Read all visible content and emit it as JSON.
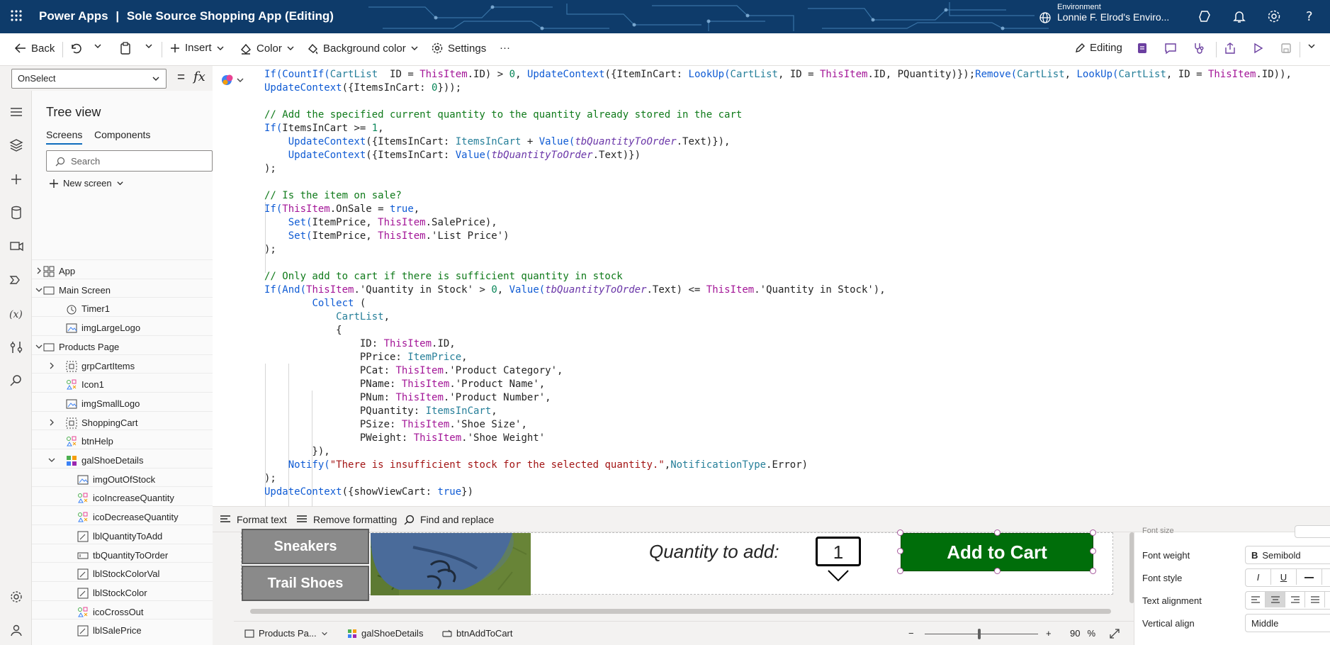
{
  "titlebar": {
    "app_name": "Power Apps",
    "separator": "|",
    "document_title": "Sole Source Shopping App (Editing)",
    "environment_label": "Environment",
    "environment_name": "Lonnie F. Elrod's Enviro..."
  },
  "commandbar": {
    "back": "Back",
    "insert": "Insert",
    "color": "Color",
    "background_color": "Background color",
    "settings": "Settings",
    "more": "···",
    "editing": "Editing"
  },
  "formulabar": {
    "property": "OnSelect",
    "equals": "=",
    "fx": "fx"
  },
  "treeview": {
    "title": "Tree view",
    "tabs": [
      "Screens",
      "Components"
    ],
    "search_placeholder": "Search",
    "new_screen": "New screen",
    "items": [
      {
        "label": "App"
      },
      {
        "label": "Main Screen"
      },
      {
        "label": "Timer1"
      },
      {
        "label": "imgLargeLogo"
      },
      {
        "label": "Products Page"
      },
      {
        "label": "grpCartItems"
      },
      {
        "label": "Icon1"
      },
      {
        "label": "imgSmallLogo"
      },
      {
        "label": "ShoppingCart"
      },
      {
        "label": "btnHelp"
      },
      {
        "label": "galShoeDetails"
      },
      {
        "label": "imgOutOfStock"
      },
      {
        "label": "icoIncreaseQuantity"
      },
      {
        "label": "icoDecreaseQuantity"
      },
      {
        "label": "lblQuantityToAdd"
      },
      {
        "label": "tbQuantityToOrder"
      },
      {
        "label": "lblStockColorVal"
      },
      {
        "label": "lblStockColor"
      },
      {
        "label": "icoCrossOut"
      },
      {
        "label": "lblSalePrice"
      }
    ]
  },
  "editor_footer": {
    "format_text": "Format text",
    "remove_formatting": "Remove formatting",
    "find_replace": "Find and replace"
  },
  "canvas": {
    "categories": [
      "Sneakers",
      "Trail Shoes"
    ],
    "quantity_label": "Quantity to add:",
    "quantity_value": "1",
    "add_to_cart": "Add to Cart"
  },
  "statusbar": {
    "crumbs": [
      "Products Pa...",
      "galShoeDetails",
      "btnAddToCart"
    ],
    "zoom_minus": "−",
    "zoom_plus": "+",
    "zoom_value": "90",
    "zoom_unit": "%"
  },
  "properties": {
    "font_size_label": "Font size",
    "font_weight_label": "Font weight",
    "font_weight_value": "Semibold",
    "font_style_label": "Font style",
    "text_alignment_label": "Text alignment",
    "vertical_align_label": "Vertical align",
    "vertical_align_value": "Middle"
  },
  "colors": {
    "titlebar": "#0e3b6a",
    "add_to_cart": "#006e0a",
    "category_tile": "#8a8a8a",
    "accent": "#0f6cbd"
  }
}
